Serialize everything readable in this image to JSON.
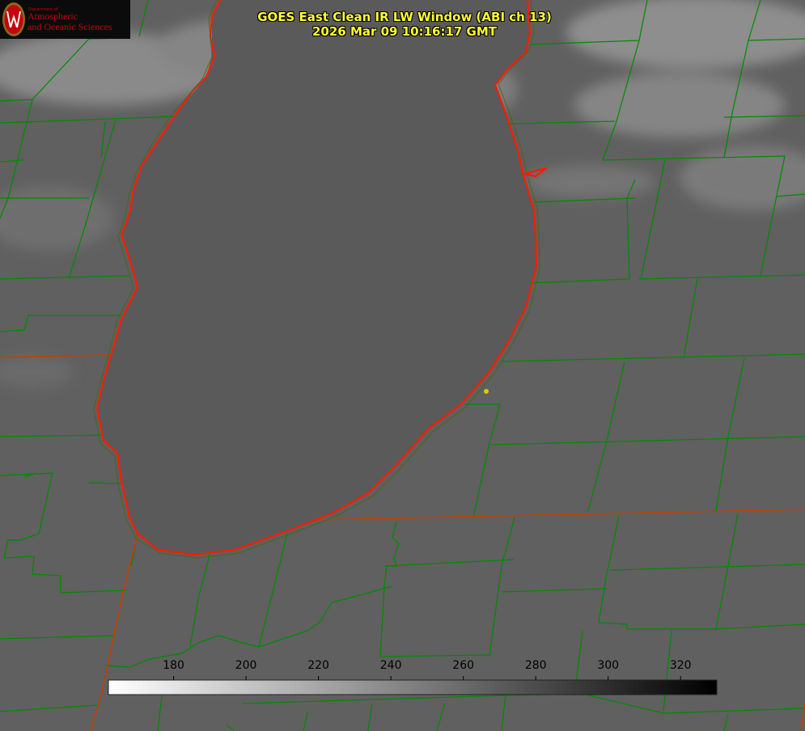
{
  "header": {
    "title_line1": "GOES East Clean IR LW Window (ABI ch 13)",
    "title_line2": "2026 Mar 09 10:16:17 GMT"
  },
  "logo": {
    "department": "Department of",
    "line1": "Atmospheric",
    "line2": "and Oceanic Sciences",
    "seal_letter": "W"
  },
  "colorbar": {
    "ticks": [
      "180",
      "200",
      "220",
      "240",
      "260",
      "280",
      "300",
      "320"
    ],
    "range": [
      162,
      330
    ],
    "ramp": [
      "#ffffff",
      "#000000"
    ]
  },
  "map_colors": {
    "lake_shore": "#ff1a00",
    "county_lines": "#008a00",
    "state_line": "#c04000",
    "marker": "#e6c800",
    "lake_fill": "#5a5a5a",
    "land_fill": "#606060"
  }
}
